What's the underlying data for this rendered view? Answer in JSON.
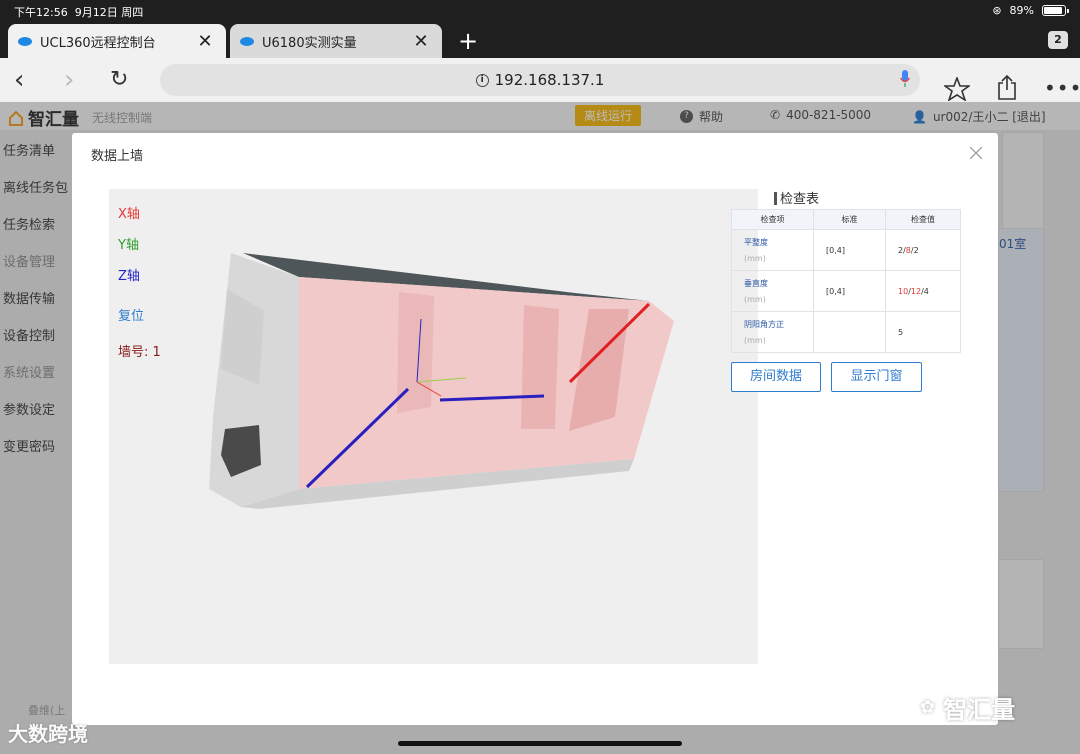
{
  "status_bar": {
    "time": "下午12:56",
    "date": "9月12日 周四",
    "battery": "89%",
    "battery_level": 0.89
  },
  "browser": {
    "tabs": [
      {
        "title": "UCL360远程控制台",
        "active": true
      },
      {
        "title": "U6180实测实量",
        "active": false
      }
    ],
    "tab_count": "2",
    "url": "192.168.137.1"
  },
  "app": {
    "brand": "智汇量",
    "subtitle": "无线控制端",
    "offline_badge": "离线运行",
    "help": "帮助",
    "phone": "400-821-5000",
    "user": "ur002/王小二 [退出]",
    "sidebar": [
      {
        "label": "任务清单",
        "muted": false
      },
      {
        "label": "离线任务包",
        "muted": false
      },
      {
        "label": "任务检索",
        "muted": false
      },
      {
        "label": "设备管理",
        "muted": true
      },
      {
        "label": "数据传输",
        "muted": false
      },
      {
        "label": "设备控制",
        "muted": false
      },
      {
        "label": "系统设置",
        "muted": true
      },
      {
        "label": "参数设定",
        "muted": false
      },
      {
        "label": "变更密码",
        "muted": false
      }
    ],
    "bg_room_label": "01室"
  },
  "modal": {
    "title": "数据上墙",
    "viewer": {
      "x_axis": "X轴",
      "y_axis": "Y轴",
      "z_axis": "Z轴",
      "reset": "复位",
      "wall_no": "墙号: 1"
    },
    "check_table": {
      "title": "检查表",
      "headers": [
        "检查项",
        "标准",
        "检查值"
      ],
      "rows": [
        {
          "name": "平整度",
          "unit": "(mm)",
          "standard": "[0,4]",
          "v1": "2",
          "v2": "8",
          "v3": "2"
        },
        {
          "name": "垂直度",
          "unit": "(mm)",
          "standard": "[0,4]",
          "v1": "10",
          "v2": "12",
          "v3": "4"
        },
        {
          "name": "阴阳角方正",
          "unit": "(mm)",
          "standard": "",
          "v1": "5"
        }
      ]
    },
    "buttons": {
      "room_data": "房间数据",
      "show_doors": "显示门窗"
    }
  },
  "watermarks": {
    "left": "大数跨境",
    "left_small": "叠维(上",
    "right": "智汇量"
  },
  "colors": {
    "x_axis": "#e53935",
    "y_axis": "#2e9e2e",
    "z_axis": "#2424c8",
    "reset": "#2f7ccf",
    "wall_no": "#8b1a1a",
    "accent": "#2f7ccf",
    "badge": "#f6b400"
  }
}
